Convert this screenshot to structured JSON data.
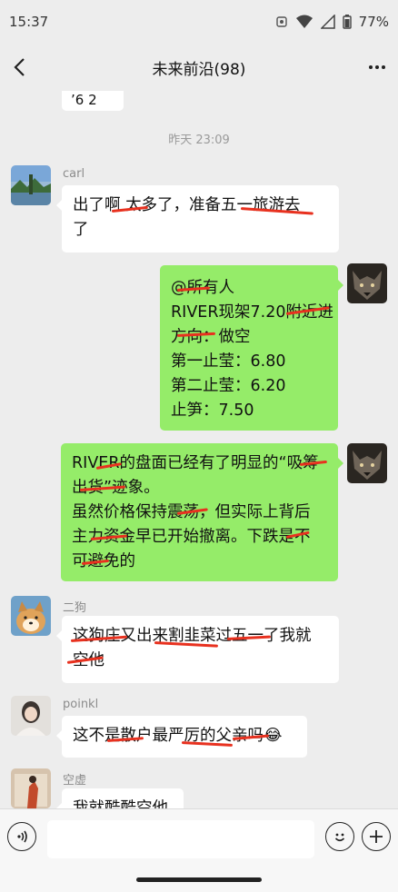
{
  "status": {
    "time": "15:37",
    "battery": "77%"
  },
  "nav": {
    "title": "未来前沿(98)"
  },
  "chat": {
    "partial_top_text": "’6 2",
    "time_separator": "昨天 23:09",
    "messages": [
      {
        "sender": "carl",
        "lines": [
          "出了啊 太多了，准备五一旅游去",
          "了"
        ]
      },
      {
        "sender": "self",
        "lines": [
          "@所有人",
          "RIVER现架7.20附近进",
          "方向：做空",
          "第一止莹：6.80",
          "第二止莹：6.20",
          "止笋：7.50"
        ]
      },
      {
        "sender": "self",
        "lines": [
          "RIVER的盘面已经有了明显的“吸筹",
          "出货”迹象。",
          "虽然价格保持震荡，但实际上背后",
          "主力资金早已开始撤离。下跌是不",
          "可避免的"
        ]
      },
      {
        "sender": "二狗",
        "lines": [
          "这狗庄又出来割韭菜过五一了我就",
          "空他"
        ]
      },
      {
        "sender": "poinkl",
        "lines": [
          "这不是散户最严厉的父亲吗"
        ],
        "emoji": "😂"
      },
      {
        "sender": "空虚",
        "lines": [
          "我就酷酷空他"
        ]
      }
    ]
  },
  "input": {
    "placeholder": ""
  },
  "colors": {
    "chat_bg": "#ededed",
    "self_bubble": "#95ec69",
    "other_bubble": "#ffffff",
    "redaction": "#e8311f"
  }
}
